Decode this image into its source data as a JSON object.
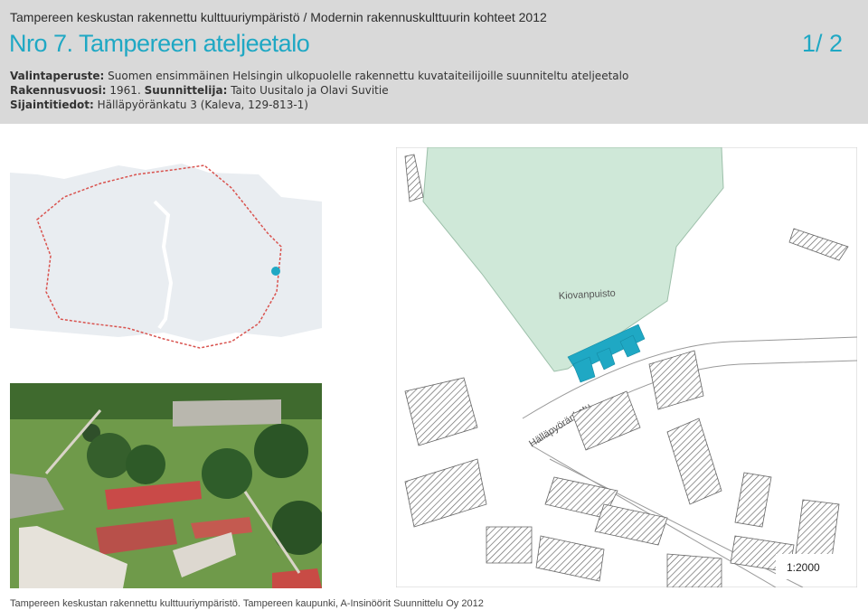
{
  "header": {
    "series": "Tampereen keskustan rakennettu kulttuuriympäristö /  Modernin rakennuskulttuurin kohteet 2012",
    "title": "Nro 7. Tampereen ateljeetalo",
    "page": "1/ 2",
    "criteria_label": "Valintaperuste:",
    "criteria_value": "Suomen ensimmäinen Helsingin ulkopuolelle rakennettu kuvataiteilijoille suunniteltu ateljeetalo",
    "year_label": "Rakennusvuosi:",
    "year_value": "1961.",
    "designer_label": "Suunnittelija:",
    "designer_value": "Taito Uusitalo ja Olavi Suvitie",
    "location_label": "Sijaintitiedot:",
    "location_value": "Hälläpyöränkatu 3 (Kaleva, 129-813-1)"
  },
  "site_map": {
    "park_label": "Kiovanpuisto",
    "street_label": "Hälläpyöränkatu",
    "scale": "1:2000"
  },
  "footer": {
    "credits": "Tampereen keskustan rakennettu kulttuuriympäristö. Tampereen kaupunki, A-Insinöörit Suunnittelu Oy 2012"
  },
  "colors": {
    "accent": "#1fa8c4",
    "header_bg": "#d9d9d9",
    "map_land": "#eef1f4",
    "park": "#cfe8d8"
  }
}
